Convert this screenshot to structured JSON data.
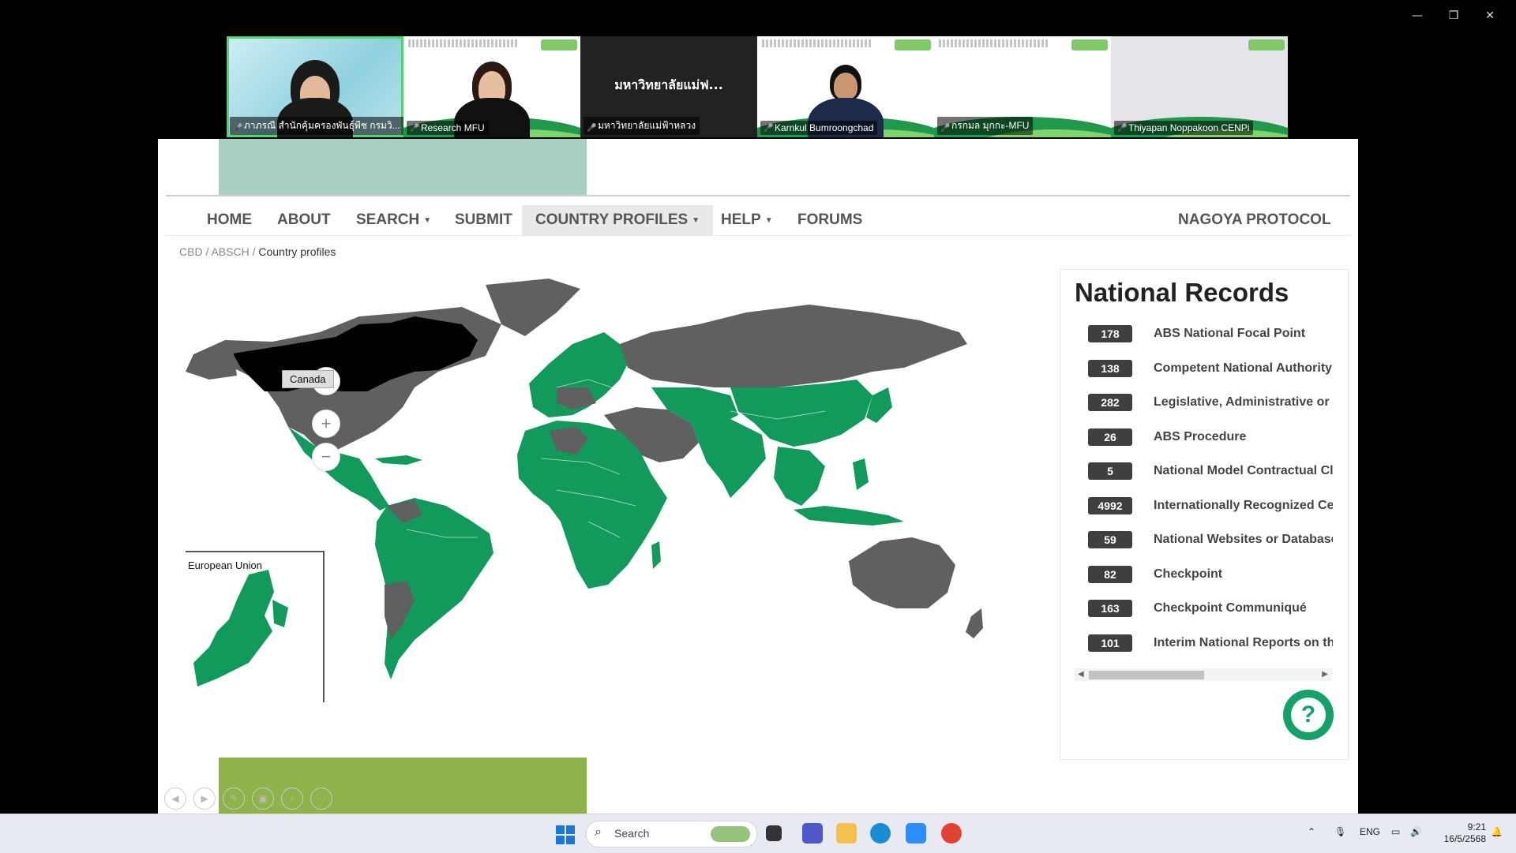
{
  "participants": [
    {
      "name": "ภาภรณี สำนักคุ้มครองพันธุ์พืช กรมวิ...",
      "mic": "on"
    },
    {
      "name": "Research MFU",
      "mic": "muted"
    },
    {
      "name": "มหาวิทยาลัยแม่ฟ้าหลวง",
      "mic": "muted",
      "center_text": "มหาวิทยาลัยแม่ฟ..."
    },
    {
      "name": "Karnkul Bumroongchad",
      "mic": "muted"
    },
    {
      "name": "กรกมล มุกกะ-MFU",
      "mic": "muted"
    },
    {
      "name": "Thiyapan Noppakoon CENPi",
      "mic": "muted"
    }
  ],
  "nav": {
    "home": "HOME",
    "about": "ABOUT",
    "search": "SEARCH",
    "submit": "SUBMIT",
    "country_profiles": "COUNTRY PROFILES",
    "help": "HELP",
    "forums": "FORUMS",
    "nagoya": "NAGOYA PROTOCOL"
  },
  "breadcrumb": {
    "cbd": "CBD",
    "absch": "ABSCH",
    "current": "Country profiles"
  },
  "map": {
    "tooltip": "Canada",
    "inset_label": "European Union",
    "colors": {
      "party": "#129a5c",
      "non_party": "#606060",
      "selected": "#000000"
    }
  },
  "records": {
    "title": "National Records",
    "items": [
      {
        "count": "178",
        "label": "ABS National Focal Point"
      },
      {
        "count": "138",
        "label": "Competent National Authority"
      },
      {
        "count": "282",
        "label": "Legislative, Administrative or Policy Measures"
      },
      {
        "count": "26",
        "label": "ABS Procedure"
      },
      {
        "count": "5",
        "label": "National Model Contractual Clauses"
      },
      {
        "count": "4992",
        "label": "Internationally Recognized Certificate of Compliance"
      },
      {
        "count": "59",
        "label": "National Websites or Databases"
      },
      {
        "count": "82",
        "label": "Checkpoint"
      },
      {
        "count": "163",
        "label": "Checkpoint Communiqué"
      },
      {
        "count": "101",
        "label": "Interim National Reports on the Implementation"
      }
    ]
  },
  "help_icon": "question-icon",
  "taskbar": {
    "search_placeholder": "Search",
    "lang": "ENG",
    "time": "9:21",
    "date": "16/5/2568"
  }
}
